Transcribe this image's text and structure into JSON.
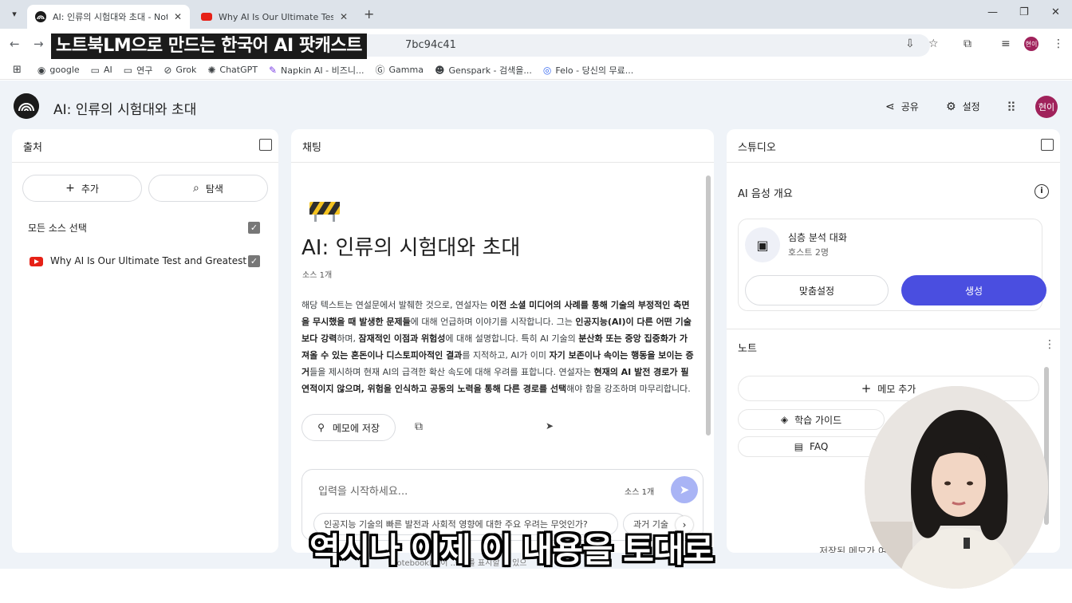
{
  "browser": {
    "tabs": [
      {
        "title": "AI: 인류의 시험대와 초대 - NotebookLM",
        "active": true
      },
      {
        "title": "Why AI Is Our Ultimate Test and Greatest Invitation",
        "active": false
      }
    ],
    "new_tab": "+",
    "url": "7bc94c41",
    "overlay_title": "노트북LM으로 만드는 한국어 AI 팟캐스트",
    "profile": "현이",
    "bookmarks": [
      {
        "label": "google",
        "icon": "globe-icon"
      },
      {
        "label": "AI",
        "icon": "folder-icon"
      },
      {
        "label": "연구",
        "icon": "folder-icon"
      },
      {
        "label": "Grok",
        "icon": "grok-icon"
      },
      {
        "label": "ChatGPT",
        "icon": "chatgpt-icon"
      },
      {
        "label": "Napkin AI - 비즈니...",
        "icon": "napkin-icon"
      },
      {
        "label": "Gamma",
        "icon": "gamma-icon"
      },
      {
        "label": "Genspark - 검색을...",
        "icon": "genspark-icon"
      },
      {
        "label": "Felo - 당신의 무료...",
        "icon": "felo-icon"
      }
    ]
  },
  "app": {
    "title": "AI: 인류의 시험대와 초대",
    "share_label": "공유",
    "settings_label": "설정",
    "avatar": "현이"
  },
  "sources": {
    "header": "출처",
    "add_label": "추가",
    "explore_label": "탐색",
    "select_all_label": "모든 소스 선택",
    "items": [
      {
        "title": "Why AI Is Our Ultimate Test and Greatest ..."
      }
    ]
  },
  "chat": {
    "header": "채팅",
    "title": "AI: 인류의 시험대와 초대",
    "source_count": "소스 1개",
    "save_to_memo": "메모에 저장",
    "input_placeholder": "입력을 시작하세요...",
    "input_source_count": "소스 1개",
    "suggestions": [
      "인공지능 기술의 빠른 발전과 사회적 영향에 대한 주요 우려는 무엇인가?",
      "과거 기술"
    ]
  },
  "studio": {
    "header": "스튜디오",
    "audio_overview_label": "AI 음성 개요",
    "audio_card_title": "심층 분석 대화",
    "audio_card_subtitle": "호스트 2명",
    "customize_label": "맞춤설정",
    "generate_label": "생성",
    "notes_header": "노트",
    "add_memo_label": "메모 추가",
    "study_guide_label": "학습 가이드",
    "faq_label": "FAQ",
    "saved_memo_text": "저장된 메모가 여"
  },
  "footer_note": "NotebookLM이 ... 보를 표시할 수 있으",
  "caption": "역시나 이제 이 내용을 토대로",
  "colors": {
    "accent": "#4a4ee0",
    "app_bg": "#eff3f8",
    "profile": "#a0225b",
    "youtube": "#e62117"
  }
}
